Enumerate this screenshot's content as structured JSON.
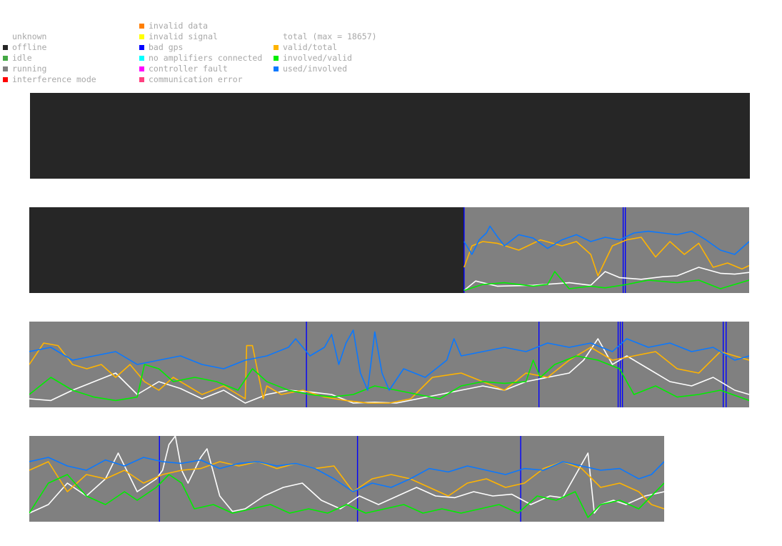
{
  "legend": {
    "col1": [
      {
        "label": "unknown",
        "color": null
      },
      {
        "label": "offline",
        "color": "#262626"
      },
      {
        "label": "idle",
        "color": "#44a844"
      },
      {
        "label": "running",
        "color": "#808080"
      },
      {
        "label": "interference mode",
        "color": "#ff0000"
      }
    ],
    "col2": [
      {
        "label": "invalid data",
        "color": "#ff7f00"
      },
      {
        "label": "invalid signal",
        "color": "#ffff00"
      },
      {
        "label": "bad gps",
        "color": "#0000ff"
      },
      {
        "label": "no amplifiers connected",
        "color": "#00ffff"
      },
      {
        "label": "controller fault",
        "color": "#ff00ff"
      },
      {
        "label": "communication error",
        "color": "#ff4080"
      }
    ],
    "col3": [
      {
        "label": "total (max = 18657)",
        "color": null
      },
      {
        "label": "valid/total",
        "color": "#ffb400"
      },
      {
        "label": "involved/valid",
        "color": "#00ee00"
      },
      {
        "label": "used/involved",
        "color": "#0a78ff"
      }
    ]
  },
  "chart_data": {
    "type": "area",
    "state_colors": {
      "offline": "#262626",
      "running": "#808080",
      "bad_gps": "#0000ff"
    },
    "series_colors": {
      "total": "#ffffff",
      "valid/total": "#ffb400",
      "involved/valid": "#00ee00",
      "used/involved": "#0a78ff"
    },
    "ylim": [
      0,
      1
    ],
    "strips": [
      {
        "length": 1,
        "states": [
          {
            "state": "offline",
            "from": 0,
            "to": 1
          }
        ],
        "bad_gps": [],
        "series": []
      },
      {
        "length": 1,
        "states": [
          {
            "state": "offline",
            "from": 0,
            "to": 0.604
          },
          {
            "state": "running",
            "from": 0.604,
            "to": 1
          }
        ],
        "bad_gps": [
          0.604,
          0.825,
          0.828
        ],
        "series": [
          {
            "name": "total",
            "x": [
              0.604,
              0.62,
              0.65,
              0.7,
              0.75,
              0.78,
              0.8,
              0.82,
              0.85,
              0.88,
              0.9,
              0.93,
              0.96,
              0.98,
              1.0
            ],
            "y": [
              0.03,
              0.14,
              0.08,
              0.09,
              0.12,
              0.09,
              0.25,
              0.18,
              0.16,
              0.19,
              0.2,
              0.3,
              0.23,
              0.22,
              0.24
            ]
          },
          {
            "name": "valid/total",
            "x": [
              0.604,
              0.615,
              0.63,
              0.65,
              0.68,
              0.71,
              0.74,
              0.76,
              0.78,
              0.79,
              0.81,
              0.83,
              0.85,
              0.87,
              0.89,
              0.91,
              0.93,
              0.95,
              0.97,
              0.99,
              1.0
            ],
            "y": [
              0.3,
              0.55,
              0.6,
              0.58,
              0.5,
              0.62,
              0.55,
              0.6,
              0.45,
              0.2,
              0.55,
              0.62,
              0.65,
              0.42,
              0.6,
              0.45,
              0.58,
              0.3,
              0.35,
              0.28,
              0.32
            ]
          },
          {
            "name": "involved/valid",
            "x": [
              0.604,
              0.63,
              0.66,
              0.7,
              0.72,
              0.73,
              0.75,
              0.78,
              0.8,
              0.83,
              0.86,
              0.9,
              0.93,
              0.96,
              1.0
            ],
            "y": [
              0.03,
              0.1,
              0.12,
              0.08,
              0.1,
              0.25,
              0.05,
              0.08,
              0.06,
              0.1,
              0.15,
              0.12,
              0.15,
              0.05,
              0.15
            ]
          },
          {
            "name": "used/involved",
            "x": [
              0.604,
              0.615,
              0.625,
              0.635,
              0.64,
              0.65,
              0.66,
              0.68,
              0.7,
              0.72,
              0.74,
              0.76,
              0.78,
              0.8,
              0.82,
              0.84,
              0.86,
              0.88,
              0.9,
              0.92,
              0.94,
              0.96,
              0.98,
              1.0
            ],
            "y": [
              0.6,
              0.45,
              0.62,
              0.7,
              0.78,
              0.66,
              0.55,
              0.68,
              0.64,
              0.52,
              0.62,
              0.68,
              0.6,
              0.65,
              0.62,
              0.7,
              0.72,
              0.7,
              0.68,
              0.72,
              0.62,
              0.5,
              0.45,
              0.6
            ]
          }
        ]
      },
      {
        "length": 1,
        "states": [
          {
            "state": "running",
            "from": 0,
            "to": 1
          }
        ],
        "bad_gps": [
          0.385,
          0.708,
          0.818,
          0.821,
          0.824,
          0.964,
          0.968
        ],
        "series": [
          {
            "name": "total",
            "x": [
              0,
              0.03,
              0.06,
              0.09,
              0.12,
              0.15,
              0.18,
              0.21,
              0.24,
              0.27,
              0.3,
              0.33,
              0.36,
              0.39,
              0.42,
              0.45,
              0.48,
              0.51,
              0.54,
              0.57,
              0.6,
              0.63,
              0.66,
              0.69,
              0.72,
              0.75,
              0.77,
              0.79,
              0.81,
              0.83,
              0.86,
              0.89,
              0.92,
              0.95,
              0.98,
              1.0
            ],
            "y": [
              0.1,
              0.08,
              0.2,
              0.3,
              0.4,
              0.15,
              0.3,
              0.22,
              0.1,
              0.2,
              0.05,
              0.15,
              0.2,
              0.18,
              0.15,
              0.05,
              0.06,
              0.05,
              0.1,
              0.15,
              0.2,
              0.25,
              0.2,
              0.3,
              0.35,
              0.4,
              0.55,
              0.8,
              0.5,
              0.6,
              0.45,
              0.3,
              0.25,
              0.35,
              0.2,
              0.15
            ]
          },
          {
            "name": "valid/total",
            "x": [
              0,
              0.02,
              0.04,
              0.06,
              0.08,
              0.1,
              0.12,
              0.14,
              0.16,
              0.18,
              0.2,
              0.22,
              0.24,
              0.27,
              0.3,
              0.302,
              0.31,
              0.325,
              0.33,
              0.35,
              0.38,
              0.41,
              0.44,
              0.47,
              0.5,
              0.53,
              0.56,
              0.6,
              0.63,
              0.66,
              0.69,
              0.72,
              0.75,
              0.78,
              0.81,
              0.84,
              0.87,
              0.9,
              0.93,
              0.96,
              0.98,
              1.0
            ],
            "y": [
              0.5,
              0.75,
              0.72,
              0.5,
              0.45,
              0.5,
              0.35,
              0.5,
              0.3,
              0.2,
              0.35,
              0.25,
              0.15,
              0.25,
              0.1,
              0.72,
              0.72,
              0.1,
              0.25,
              0.15,
              0.2,
              0.12,
              0.08,
              0.05,
              0.05,
              0.1,
              0.35,
              0.4,
              0.3,
              0.2,
              0.4,
              0.35,
              0.55,
              0.7,
              0.55,
              0.6,
              0.65,
              0.45,
              0.4,
              0.65,
              0.6,
              0.55
            ]
          },
          {
            "name": "involved/valid",
            "x": [
              0,
              0.03,
              0.06,
              0.09,
              0.12,
              0.15,
              0.16,
              0.18,
              0.2,
              0.23,
              0.26,
              0.29,
              0.31,
              0.33,
              0.36,
              0.39,
              0.42,
              0.45,
              0.48,
              0.51,
              0.54,
              0.57,
              0.6,
              0.63,
              0.66,
              0.69,
              0.7,
              0.71,
              0.73,
              0.76,
              0.79,
              0.82,
              0.84,
              0.87,
              0.9,
              0.93,
              0.96,
              1.0
            ],
            "y": [
              0.15,
              0.35,
              0.2,
              0.12,
              0.08,
              0.12,
              0.5,
              0.45,
              0.3,
              0.35,
              0.3,
              0.2,
              0.45,
              0.3,
              0.2,
              0.15,
              0.12,
              0.15,
              0.25,
              0.2,
              0.15,
              0.1,
              0.25,
              0.3,
              0.28,
              0.3,
              0.55,
              0.35,
              0.5,
              0.6,
              0.55,
              0.45,
              0.15,
              0.25,
              0.12,
              0.15,
              0.2,
              0.08
            ]
          },
          {
            "name": "used/involved",
            "x": [
              0,
              0.03,
              0.06,
              0.09,
              0.12,
              0.15,
              0.18,
              0.21,
              0.24,
              0.27,
              0.3,
              0.33,
              0.36,
              0.37,
              0.39,
              0.41,
              0.42,
              0.43,
              0.44,
              0.45,
              0.46,
              0.47,
              0.48,
              0.49,
              0.5,
              0.52,
              0.55,
              0.58,
              0.59,
              0.6,
              0.63,
              0.66,
              0.69,
              0.72,
              0.75,
              0.78,
              0.81,
              0.83,
              0.86,
              0.89,
              0.92,
              0.95,
              0.98,
              1.0
            ],
            "y": [
              0.65,
              0.7,
              0.55,
              0.6,
              0.65,
              0.5,
              0.55,
              0.6,
              0.5,
              0.45,
              0.55,
              0.6,
              0.7,
              0.8,
              0.6,
              0.7,
              0.85,
              0.5,
              0.75,
              0.9,
              0.4,
              0.2,
              0.88,
              0.4,
              0.2,
              0.45,
              0.35,
              0.55,
              0.8,
              0.6,
              0.65,
              0.7,
              0.65,
              0.75,
              0.7,
              0.75,
              0.65,
              0.8,
              0.7,
              0.75,
              0.65,
              0.7,
              0.55,
              0.6
            ]
          }
        ]
      },
      {
        "length": 0.8815,
        "states": [
          {
            "state": "running",
            "from": 0,
            "to": 1
          }
        ],
        "bad_gps": [
          0.205,
          0.517,
          0.774
        ],
        "series": [
          {
            "name": "total",
            "x": [
              0,
              0.03,
              0.06,
              0.09,
              0.12,
              0.14,
              0.17,
              0.2,
              0.21,
              0.22,
              0.23,
              0.24,
              0.25,
              0.27,
              0.28,
              0.3,
              0.32,
              0.34,
              0.37,
              0.4,
              0.43,
              0.46,
              0.49,
              0.52,
              0.55,
              0.58,
              0.61,
              0.64,
              0.67,
              0.7,
              0.73,
              0.76,
              0.79,
              0.82,
              0.84,
              0.88,
              0.89,
              0.9,
              0.92,
              0.94,
              0.97,
              1.0
            ],
            "y": [
              0.1,
              0.2,
              0.45,
              0.3,
              0.5,
              0.8,
              0.35,
              0.5,
              0.6,
              0.9,
              1.0,
              0.6,
              0.45,
              0.75,
              0.85,
              0.3,
              0.12,
              0.15,
              0.3,
              0.4,
              0.45,
              0.25,
              0.15,
              0.3,
              0.2,
              0.3,
              0.4,
              0.3,
              0.28,
              0.35,
              0.3,
              0.32,
              0.2,
              0.3,
              0.28,
              0.8,
              0.1,
              0.2,
              0.25,
              0.2,
              0.3,
              0.35
            ]
          },
          {
            "name": "valid/total",
            "x": [
              0,
              0.03,
              0.06,
              0.09,
              0.12,
              0.15,
              0.18,
              0.21,
              0.24,
              0.27,
              0.3,
              0.33,
              0.36,
              0.39,
              0.42,
              0.45,
              0.48,
              0.51,
              0.54,
              0.57,
              0.6,
              0.63,
              0.66,
              0.69,
              0.72,
              0.75,
              0.78,
              0.81,
              0.84,
              0.87,
              0.9,
              0.93,
              0.96,
              0.98,
              1.0
            ],
            "y": [
              0.6,
              0.7,
              0.35,
              0.55,
              0.5,
              0.6,
              0.45,
              0.55,
              0.6,
              0.62,
              0.7,
              0.65,
              0.7,
              0.62,
              0.68,
              0.62,
              0.65,
              0.35,
              0.5,
              0.55,
              0.5,
              0.4,
              0.3,
              0.45,
              0.5,
              0.4,
              0.45,
              0.62,
              0.7,
              0.62,
              0.4,
              0.45,
              0.35,
              0.2,
              0.15
            ]
          },
          {
            "name": "involved/valid",
            "x": [
              0,
              0.03,
              0.06,
              0.09,
              0.12,
              0.15,
              0.17,
              0.2,
              0.22,
              0.24,
              0.26,
              0.29,
              0.32,
              0.35,
              0.38,
              0.41,
              0.44,
              0.47,
              0.5,
              0.53,
              0.56,
              0.59,
              0.62,
              0.65,
              0.68,
              0.71,
              0.74,
              0.77,
              0.8,
              0.83,
              0.86,
              0.88,
              0.9,
              0.93,
              0.96,
              1.0
            ],
            "y": [
              0.1,
              0.45,
              0.55,
              0.3,
              0.2,
              0.35,
              0.25,
              0.4,
              0.55,
              0.45,
              0.15,
              0.2,
              0.1,
              0.15,
              0.2,
              0.1,
              0.15,
              0.1,
              0.2,
              0.1,
              0.15,
              0.2,
              0.1,
              0.15,
              0.1,
              0.15,
              0.2,
              0.1,
              0.3,
              0.25,
              0.35,
              0.05,
              0.2,
              0.25,
              0.15,
              0.45
            ]
          },
          {
            "name": "used/involved",
            "x": [
              0,
              0.03,
              0.06,
              0.09,
              0.12,
              0.15,
              0.18,
              0.21,
              0.24,
              0.27,
              0.3,
              0.33,
              0.36,
              0.39,
              0.42,
              0.45,
              0.48,
              0.51,
              0.54,
              0.57,
              0.6,
              0.63,
              0.66,
              0.69,
              0.72,
              0.75,
              0.78,
              0.81,
              0.84,
              0.87,
              0.9,
              0.93,
              0.96,
              0.98,
              1.0
            ],
            "y": [
              0.7,
              0.75,
              0.65,
              0.6,
              0.72,
              0.65,
              0.75,
              0.7,
              0.68,
              0.72,
              0.62,
              0.68,
              0.7,
              0.65,
              0.68,
              0.62,
              0.5,
              0.35,
              0.45,
              0.4,
              0.5,
              0.62,
              0.58,
              0.65,
              0.6,
              0.55,
              0.62,
              0.6,
              0.7,
              0.65,
              0.6,
              0.62,
              0.5,
              0.55,
              0.7
            ]
          }
        ]
      }
    ]
  }
}
